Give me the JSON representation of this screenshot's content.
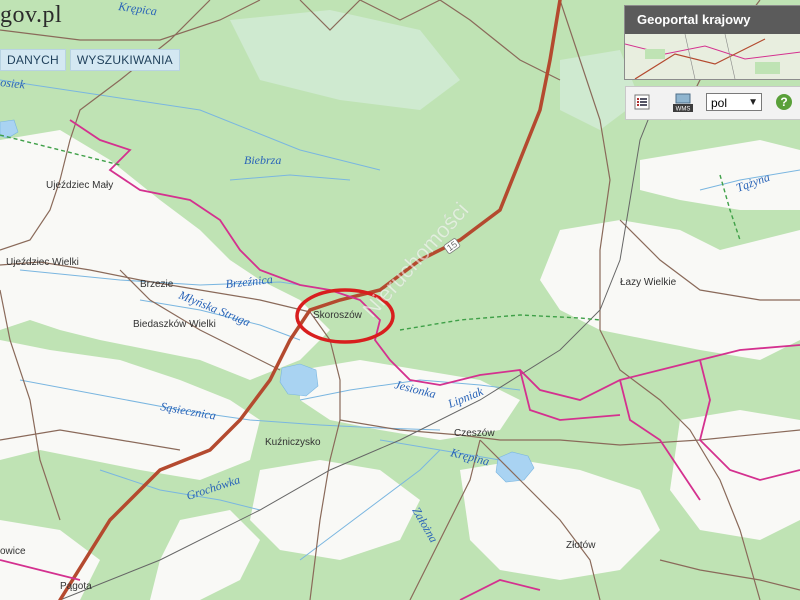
{
  "header": {
    "logo_text": "gov.pl",
    "tabs": [
      {
        "label": "DANYCH"
      },
      {
        "label": "WYSZUKIWANIA"
      }
    ]
  },
  "overview": {
    "title": "Geoportal krajowy"
  },
  "toolbar": {
    "language": "pol",
    "help": "?"
  },
  "map": {
    "towns": {
      "ujazdziec_maly": "Ujeździec Mały",
      "ujazdziec_wielki": "Ujeździec Wielki",
      "brzezie": "Brzezie",
      "biedaszkow": "Biedaszków Wielki",
      "skoroszow": "Skoroszów",
      "lazy": "Łazy Wielkie",
      "kuzniczysko": "Kuźniczysko",
      "czeszow": "Czeszów",
      "zlotow": "Złotów",
      "bukowice": "owice",
      "pagota": "Pągota"
    },
    "rivers": {
      "biebrza": "Biebrza",
      "brzeznica": "Brzeźnica",
      "mlynska": "Młyńska Struga",
      "jesionka": "Jesionka",
      "sasiecznica": "Sąsiecznica",
      "lipniak": "Lipniak",
      "krepina": "Krępina",
      "grochowka": "Grochówka",
      "zalozna": "Założna",
      "tazyna": "Tążyna",
      "krepica": "Krępica",
      "osiek": "osiek"
    },
    "road_number": "15",
    "watermark": "Nieruchomości"
  },
  "colors": {
    "forest": "#bfe3b4",
    "open_land": "#f9f9f6",
    "main_road": "#b44a2f",
    "boundary": "#d4318f",
    "water": "#a9d3f2",
    "marker": "#d81e1e",
    "river_label": "#2a64b8"
  }
}
